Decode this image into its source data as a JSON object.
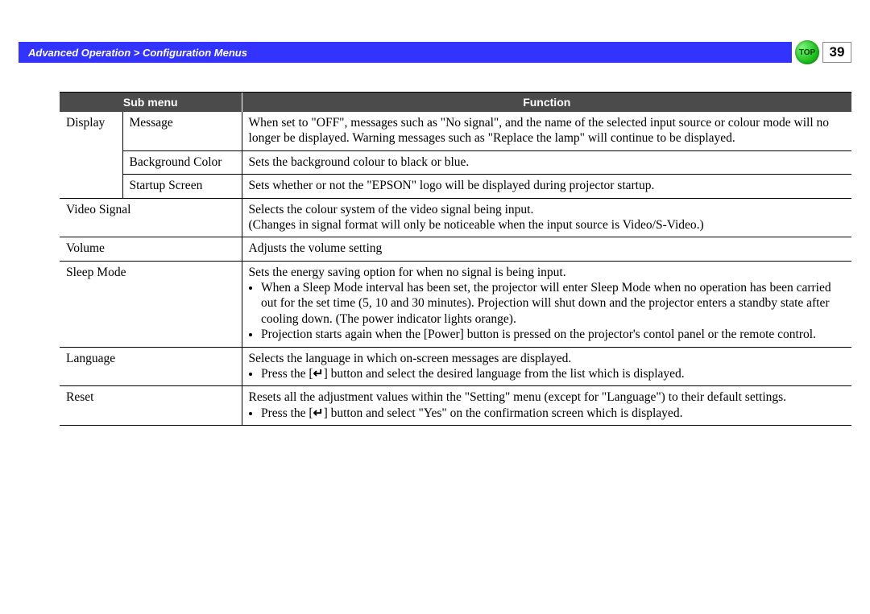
{
  "header": {
    "breadcrumb": "Advanced Operation > Configuration Menus",
    "top_label": "TOP",
    "page_number": "39"
  },
  "table": {
    "headers": {
      "submenu": "Sub menu",
      "function": "Function"
    },
    "rows": {
      "display": "Display",
      "message": "Message",
      "message_fn": "When set to \"OFF\", messages such as \"No signal\", and the name of the selected input source or colour mode will no longer be displayed. Warning messages such as \"Replace the lamp\" will continue to be displayed.",
      "bgcolor": "Background Color",
      "bgcolor_fn": "Sets the background colour to black or blue.",
      "startup": "Startup Screen",
      "startup_fn": "Sets whether or not the \"EPSON\" logo will be displayed during projector startup.",
      "video": "Video Signal",
      "video_fn_l1": "Selects the colour system of the video signal being input.",
      "video_fn_l2": "(Changes in signal format will only be noticeable when the input source is Video/S-Video.)",
      "volume": "Volume",
      "volume_fn": "Adjusts the volume setting",
      "sleep": "Sleep Mode",
      "sleep_fn_lead": "Sets the energy saving option for when no signal is being input.",
      "sleep_fn_b1": "When a Sleep Mode interval has been set, the projector will enter Sleep Mode when no operation has been carried out for the set time (5, 10 and 30 minutes). Projection will shut down and the projector enters a standby state after cooling down. (The power indicator lights orange).",
      "sleep_fn_b2": "Projection starts again when the [Power] button is pressed on the projector's contol panel or the remote control.",
      "language": "Language",
      "language_fn_lead": "Selects the language in which on-screen messages are displayed.",
      "language_fn_b1a": "Press the [",
      "language_fn_b1b": "] button and select the desired language from the list which is displayed.",
      "reset": "Reset",
      "reset_fn_lead": "Resets all the adjustment values within the \"Setting\" menu (except for \"Language\") to their default settings.",
      "reset_fn_b1a": "Press the [",
      "reset_fn_b1b": "] button and select \"Yes\" on the confirmation screen which is displayed."
    }
  },
  "glyphs": {
    "enter": "↵"
  }
}
